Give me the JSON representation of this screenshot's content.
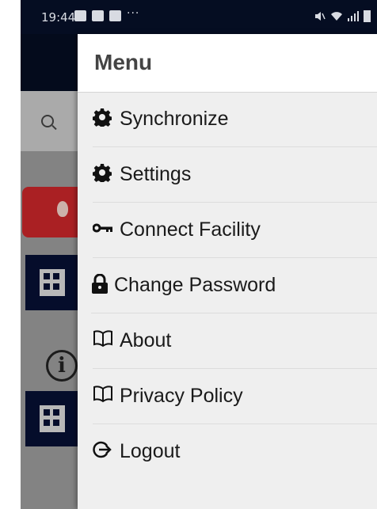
{
  "status_bar": {
    "time": "19:44",
    "left_icons": [
      "message-icon",
      "linkedin-icon",
      "youtube-icon",
      "more-dots-icon"
    ],
    "right_icons": [
      "mute-icon",
      "wifi-icon",
      "signal-icon",
      "battery-icon"
    ]
  },
  "drawer": {
    "title": "Menu",
    "items": [
      {
        "label": "Synchronize",
        "icon": "gear-icon"
      },
      {
        "label": "Settings",
        "icon": "gear-icon"
      },
      {
        "label": "Connect Facility",
        "icon": "key-icon"
      },
      {
        "label": "Change Password",
        "icon": "lock-icon"
      },
      {
        "label": "About",
        "icon": "book-icon"
      },
      {
        "label": "Privacy Policy",
        "icon": "book-icon"
      },
      {
        "label": "Logout",
        "icon": "logout-icon"
      }
    ]
  },
  "colors": {
    "status_bar_bg": "#050d22",
    "drawer_bg": "#efefef",
    "header_bg": "#ffffff",
    "accent_red": "#c8262a",
    "tile_navy": "#071033"
  }
}
